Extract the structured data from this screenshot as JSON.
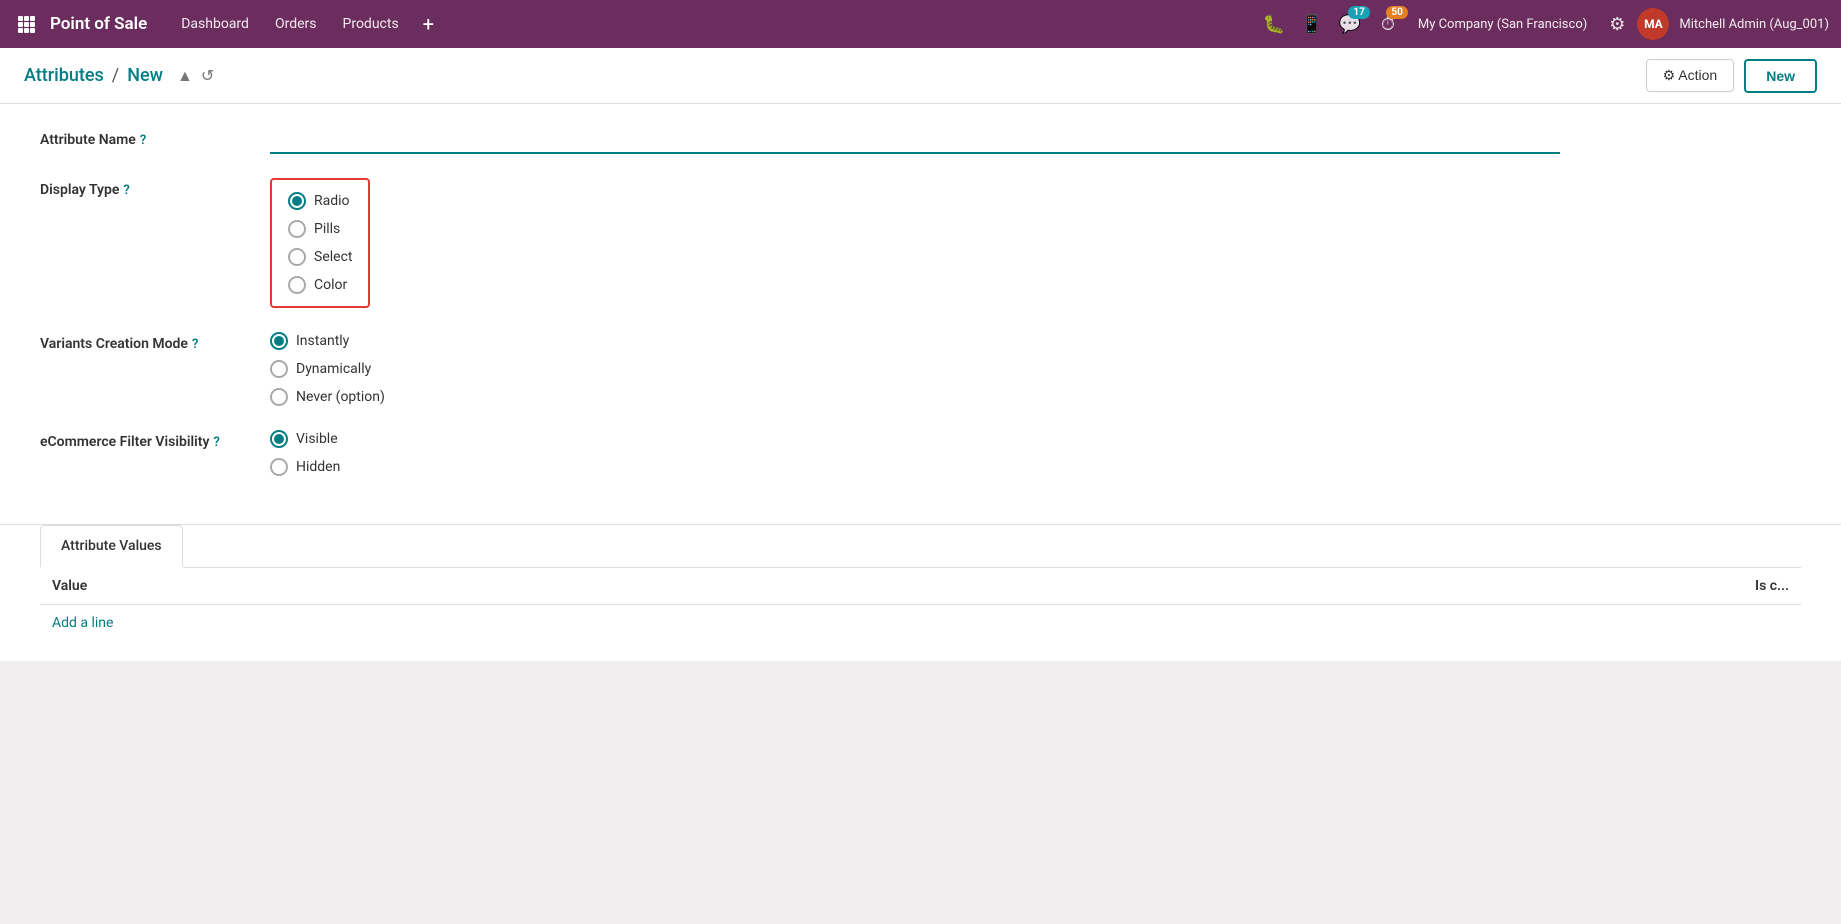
{
  "app": {
    "brand": "Point of Sale"
  },
  "topnav": {
    "menu": [
      {
        "label": "Dashboard",
        "id": "dashboard"
      },
      {
        "label": "Orders",
        "id": "orders"
      },
      {
        "label": "Products",
        "id": "products"
      }
    ],
    "plus_label": "+",
    "notifications": [
      {
        "icon": "bug",
        "badge": null
      },
      {
        "icon": "phone",
        "badge": null
      },
      {
        "icon": "chat",
        "badge": "17"
      },
      {
        "icon": "clock",
        "badge": "50"
      }
    ],
    "company": "My Company (San Francisco)",
    "wrench_icon": "⚙",
    "user_name": "Mitchell Admin (Aug_001)"
  },
  "breadcrumb": {
    "parent": "Attributes",
    "separator": "/",
    "current": "New",
    "upload_title": "Upload",
    "undo_title": "Undo"
  },
  "toolbar": {
    "action_label": "⚙ Action",
    "new_label": "New"
  },
  "form": {
    "attribute_name_label": "Attribute Name",
    "attribute_name_help": "?",
    "attribute_name_placeholder": "",
    "display_type_label": "Display Type",
    "display_type_help": "?",
    "display_type_options": [
      {
        "value": "radio",
        "label": "Radio",
        "checked": true
      },
      {
        "value": "pills",
        "label": "Pills",
        "checked": false
      },
      {
        "value": "select",
        "label": "Select",
        "checked": false
      },
      {
        "value": "color",
        "label": "Color",
        "checked": false
      }
    ],
    "variants_creation_mode_label": "Variants Creation Mode",
    "variants_creation_mode_help": "?",
    "variants_creation_mode_options": [
      {
        "value": "instantly",
        "label": "Instantly",
        "checked": true
      },
      {
        "value": "dynamically",
        "label": "Dynamically",
        "checked": false
      },
      {
        "value": "never",
        "label": "Never (option)",
        "checked": false
      }
    ],
    "ecommerce_filter_label": "eCommerce Filter Visibility",
    "ecommerce_filter_help": "?",
    "ecommerce_filter_options": [
      {
        "value": "visible",
        "label": "Visible",
        "checked": true
      },
      {
        "value": "hidden",
        "label": "Hidden",
        "checked": false
      }
    ]
  },
  "tabs": [
    {
      "label": "Attribute Values",
      "active": true
    }
  ],
  "table": {
    "columns": [
      {
        "label": "Value"
      },
      {
        "label": "Is c..."
      }
    ],
    "rows": [],
    "add_line_label": "Add a line"
  }
}
